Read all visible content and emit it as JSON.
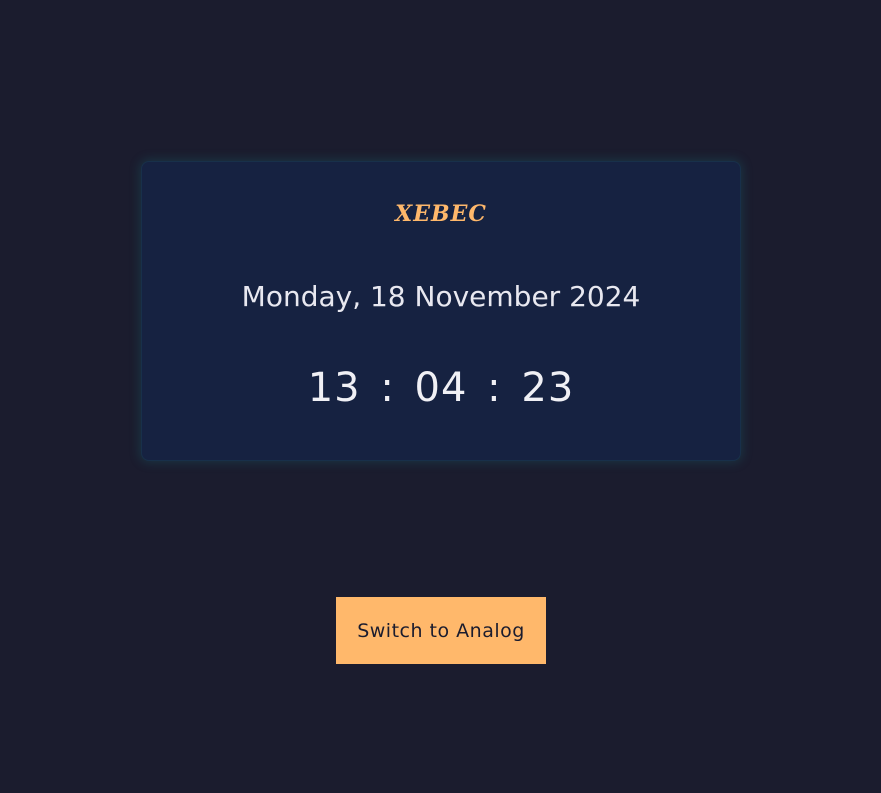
{
  "card": {
    "brand": "XEBEC",
    "date": "Monday, 18 November 2024",
    "time": {
      "hours": "13",
      "minutes": "04",
      "seconds": "23",
      "separator": ":"
    }
  },
  "actions": {
    "switch_label": "Switch to Analog"
  },
  "colors": {
    "background": "#1b1c2e",
    "card": "#162241",
    "accent": "#ffb86b",
    "text": "#e8e8f0"
  }
}
